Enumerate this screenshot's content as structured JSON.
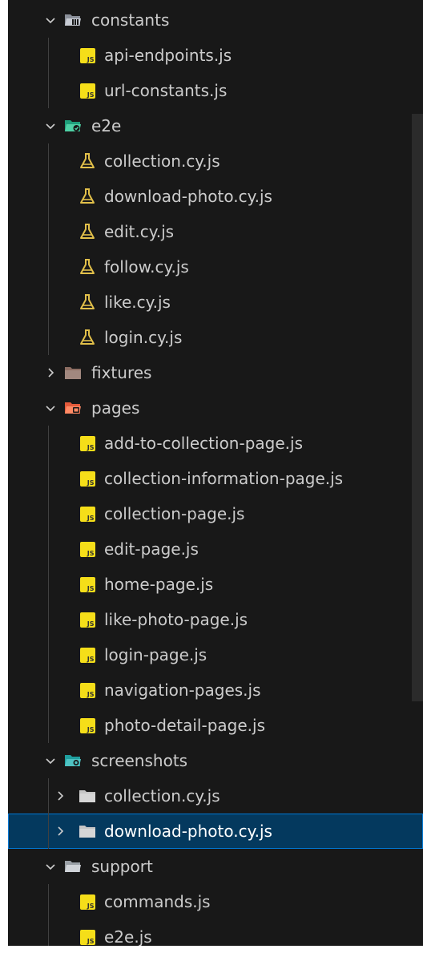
{
  "tree": [
    {
      "label": "constants",
      "type": "folder",
      "expanded": true,
      "depth": 0,
      "icon": "folder-constants-icon"
    },
    {
      "label": "api-endpoints.js",
      "type": "file",
      "depth": 1,
      "icon": "js-file-icon"
    },
    {
      "label": "url-constants.js",
      "type": "file",
      "depth": 1,
      "icon": "js-file-icon"
    },
    {
      "label": "e2e",
      "type": "folder",
      "expanded": true,
      "depth": 0,
      "icon": "folder-e2e-icon"
    },
    {
      "label": "collection.cy.js",
      "type": "file",
      "depth": 1,
      "icon": "cypress-test-icon"
    },
    {
      "label": "download-photo.cy.js",
      "type": "file",
      "depth": 1,
      "icon": "cypress-test-icon"
    },
    {
      "label": "edit.cy.js",
      "type": "file",
      "depth": 1,
      "icon": "cypress-test-icon"
    },
    {
      "label": "follow.cy.js",
      "type": "file",
      "depth": 1,
      "icon": "cypress-test-icon"
    },
    {
      "label": "like.cy.js",
      "type": "file",
      "depth": 1,
      "icon": "cypress-test-icon"
    },
    {
      "label": "login.cy.js",
      "type": "file",
      "depth": 1,
      "icon": "cypress-test-icon"
    },
    {
      "label": "fixtures",
      "type": "folder",
      "expanded": false,
      "depth": 0,
      "icon": "folder-fixtures-icon"
    },
    {
      "label": "pages",
      "type": "folder",
      "expanded": true,
      "depth": 0,
      "icon": "folder-pages-icon"
    },
    {
      "label": "add-to-collection-page.js",
      "type": "file",
      "depth": 1,
      "icon": "js-file-icon"
    },
    {
      "label": "collection-information-page.js",
      "type": "file",
      "depth": 1,
      "icon": "js-file-icon"
    },
    {
      "label": "collection-page.js",
      "type": "file",
      "depth": 1,
      "icon": "js-file-icon"
    },
    {
      "label": "edit-page.js",
      "type": "file",
      "depth": 1,
      "icon": "js-file-icon"
    },
    {
      "label": "home-page.js",
      "type": "file",
      "depth": 1,
      "icon": "js-file-icon"
    },
    {
      "label": "like-photo-page.js",
      "type": "file",
      "depth": 1,
      "icon": "js-file-icon"
    },
    {
      "label": "login-page.js",
      "type": "file",
      "depth": 1,
      "icon": "js-file-icon"
    },
    {
      "label": "navigation-pages.js",
      "type": "file",
      "depth": 1,
      "icon": "js-file-icon"
    },
    {
      "label": "photo-detail-page.js",
      "type": "file",
      "depth": 1,
      "icon": "js-file-icon"
    },
    {
      "label": "screenshots",
      "type": "folder",
      "expanded": true,
      "depth": 0,
      "icon": "folder-screenshots-icon"
    },
    {
      "label": "collection.cy.js",
      "type": "folder",
      "expanded": false,
      "depth": 1,
      "icon": "folder-icon"
    },
    {
      "label": "download-photo.cy.js",
      "type": "folder",
      "expanded": false,
      "depth": 1,
      "icon": "folder-icon",
      "selected": true
    },
    {
      "label": "support",
      "type": "folder",
      "expanded": true,
      "depth": 0,
      "icon": "folder-support-icon"
    },
    {
      "label": "commands.js",
      "type": "file",
      "depth": 1,
      "icon": "js-file-icon"
    },
    {
      "label": "e2e.js",
      "type": "file",
      "depth": 1,
      "icon": "js-file-icon"
    }
  ],
  "colors": {
    "background": "#181818",
    "text": "#cccccc",
    "selected_background": "#04395e",
    "selected_border": "#0078d4",
    "js_badge": "#f5de19",
    "cypress_icon": "#e2c04a",
    "folder_default": "#c5c5c5"
  }
}
